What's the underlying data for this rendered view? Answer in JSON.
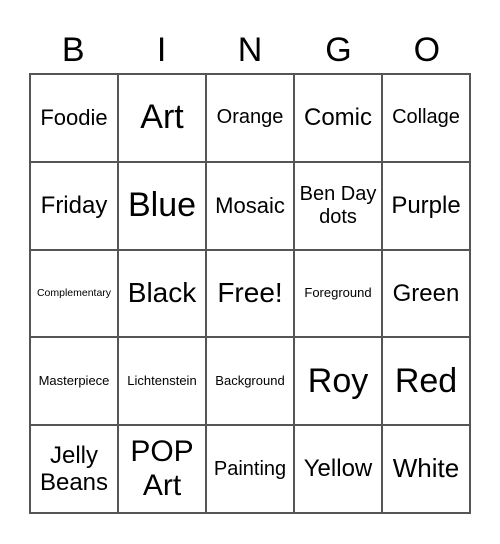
{
  "header": [
    "B",
    "I",
    "N",
    "G",
    "O"
  ],
  "cells": [
    {
      "text": "Foodie",
      "size": "s22"
    },
    {
      "text": "Art",
      "size": "s34"
    },
    {
      "text": "Orange",
      "size": "s20"
    },
    {
      "text": "Comic",
      "size": "s24"
    },
    {
      "text": "Collage",
      "size": "s20"
    },
    {
      "text": "Friday",
      "size": "s24"
    },
    {
      "text": "Blue",
      "size": "s34"
    },
    {
      "text": "Mosaic",
      "size": "s22"
    },
    {
      "text": "Ben Day dots",
      "size": "s20"
    },
    {
      "text": "Purple",
      "size": "s24"
    },
    {
      "text": "Complementary",
      "size": "s10"
    },
    {
      "text": "Black",
      "size": "s28"
    },
    {
      "text": "Free!",
      "size": "s28"
    },
    {
      "text": "Foreground",
      "size": "s13"
    },
    {
      "text": "Green",
      "size": "s24"
    },
    {
      "text": "Masterpiece",
      "size": "s13"
    },
    {
      "text": "Lichtenstein",
      "size": "s13"
    },
    {
      "text": "Background",
      "size": "s13"
    },
    {
      "text": "Roy",
      "size": "s34"
    },
    {
      "text": "Red",
      "size": "s34"
    },
    {
      "text": "Jelly Beans",
      "size": "s24"
    },
    {
      "text": "POP Art",
      "size": "s30"
    },
    {
      "text": "Painting",
      "size": "s20"
    },
    {
      "text": "Yellow",
      "size": "s24"
    },
    {
      "text": "White",
      "size": "s26"
    }
  ]
}
